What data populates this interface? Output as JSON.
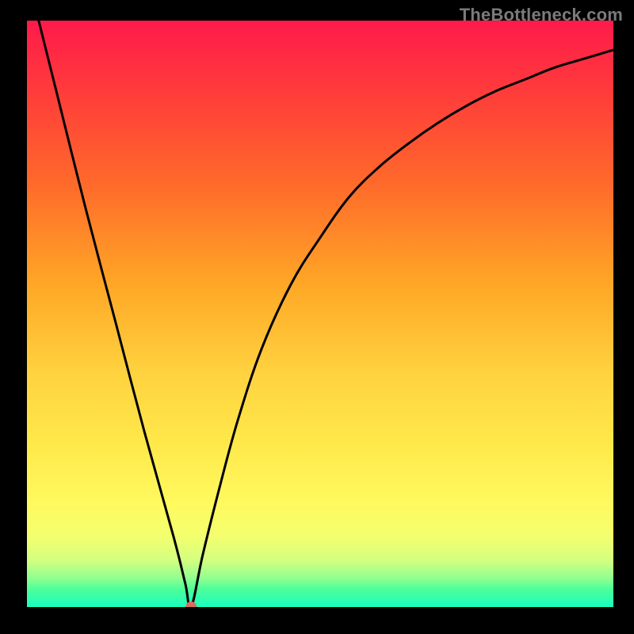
{
  "watermark": "TheBottleneck.com",
  "chart_data": {
    "type": "line",
    "title": "",
    "xlabel": "",
    "ylabel": "",
    "xlim": [
      0,
      100
    ],
    "ylim": [
      0,
      100
    ],
    "grid": false,
    "legend": false,
    "series": [
      {
        "name": "curve",
        "x": [
          0,
          5,
          10,
          15,
          20,
          25,
          27,
          28,
          30,
          33,
          36,
          40,
          45,
          50,
          55,
          60,
          65,
          70,
          75,
          80,
          85,
          90,
          95,
          100
        ],
        "y": [
          108,
          88,
          68,
          49,
          30,
          12,
          4,
          0,
          9,
          21,
          32,
          44,
          55,
          63,
          70,
          75,
          79,
          82.5,
          85.5,
          88,
          90,
          92,
          93.5,
          95
        ]
      }
    ],
    "marker": {
      "x": 28,
      "y": 0,
      "color": "#db6b5c",
      "radius_px": 7
    },
    "background_gradient": {
      "direction": "vertical",
      "stops": [
        {
          "pos": 0.0,
          "color": "#ff1a4b"
        },
        {
          "pos": 0.12,
          "color": "#ff3b3b"
        },
        {
          "pos": 0.28,
          "color": "#ff6a2a"
        },
        {
          "pos": 0.45,
          "color": "#ffa726"
        },
        {
          "pos": 0.6,
          "color": "#ffd23f"
        },
        {
          "pos": 0.72,
          "color": "#ffe84a"
        },
        {
          "pos": 0.82,
          "color": "#fff95e"
        },
        {
          "pos": 0.88,
          "color": "#f3ff6e"
        },
        {
          "pos": 0.92,
          "color": "#d3ff80"
        },
        {
          "pos": 0.95,
          "color": "#93ff8f"
        },
        {
          "pos": 0.97,
          "color": "#4cff9a"
        },
        {
          "pos": 1.0,
          "color": "#19ffbf"
        }
      ]
    }
  }
}
